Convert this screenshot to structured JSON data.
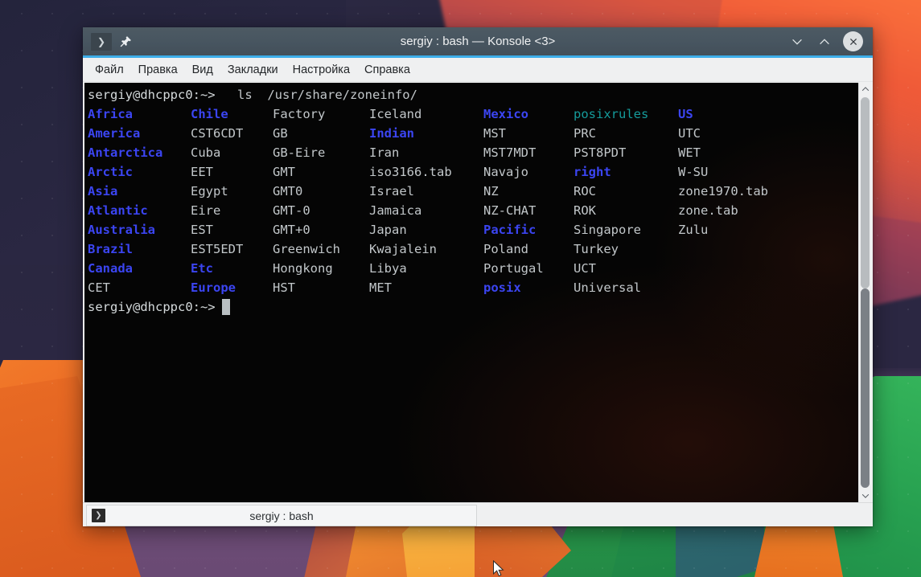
{
  "window": {
    "title": "sergiy : bash — Konsole <3>",
    "new_tab_icon": "terminal-chevron-icon",
    "pin_icon": "pin-icon",
    "minimize_icon": "chevron-down-icon",
    "maximize_icon": "chevron-up-icon",
    "close_icon": "close-icon",
    "accent_color": "#3daee9",
    "titlebar_color": "#475560"
  },
  "menubar": {
    "items": [
      {
        "label": "Файл"
      },
      {
        "label": "Правка"
      },
      {
        "label": "Вид"
      },
      {
        "label": "Закладки"
      },
      {
        "label": "Настройка"
      },
      {
        "label": "Справка"
      }
    ]
  },
  "terminal": {
    "background_color": "#050505",
    "foreground_color": "#c8cdd0",
    "dir_color": "#3b45f2",
    "link_color": "#159b9b",
    "prompt_first": "sergiy@dhcppc0:~>",
    "command": "ls  /usr/share/zoneinfo/",
    "prompt_last": "sergiy@dhcppc0:~>",
    "cursor": "block",
    "columns": [
      [
        "Africa",
        "America",
        "Antarctica",
        "Arctic",
        "Asia",
        "Atlantic",
        "Australia",
        "Brazil",
        "Canada",
        "CET"
      ],
      [
        "Chile",
        "CST6CDT",
        "Cuba",
        "EET",
        "Egypt",
        "Eire",
        "EST",
        "EST5EDT",
        "Etc",
        "Europe"
      ],
      [
        "Factory",
        "GB",
        "GB-Eire",
        "GMT",
        "GMT0",
        "GMT-0",
        "GMT+0",
        "Greenwich",
        "Hongkong",
        "HST"
      ],
      [
        "Iceland",
        "Indian",
        "Iran",
        "iso3166.tab",
        "Israel",
        "Jamaica",
        "Japan",
        "Kwajalein",
        "Libya",
        "MET"
      ],
      [
        "Mexico",
        "MST",
        "MST7MDT",
        "Navajo",
        "NZ",
        "NZ-CHAT",
        "Pacific",
        "Poland",
        "Portugal",
        "posix"
      ],
      [
        "posixrules",
        "PRC",
        "PST8PDT",
        "right",
        "ROC",
        "ROK",
        "Singapore",
        "Turkey",
        "UCT",
        "Universal"
      ],
      [
        "US",
        "UTC",
        "WET",
        "W-SU",
        "zone1970.tab",
        "zone.tab",
        "Zulu",
        "",
        "",
        ""
      ]
    ],
    "types": [
      [
        "dir",
        "dir",
        "dir",
        "dir",
        "dir",
        "dir",
        "dir",
        "dir",
        "dir",
        "file"
      ],
      [
        "dir",
        "file",
        "file",
        "file",
        "file",
        "file",
        "file",
        "file",
        "dir",
        "dir"
      ],
      [
        "file",
        "file",
        "file",
        "file",
        "file",
        "file",
        "file",
        "file",
        "file",
        "file"
      ],
      [
        "file",
        "dir",
        "file",
        "file",
        "file",
        "file",
        "file",
        "file",
        "file",
        "file"
      ],
      [
        "dir",
        "file",
        "file",
        "file",
        "file",
        "file",
        "dir",
        "file",
        "file",
        "dir"
      ],
      [
        "link",
        "file",
        "file",
        "dir",
        "file",
        "file",
        "file",
        "file",
        "file",
        "file"
      ],
      [
        "dir",
        "file",
        "file",
        "file",
        "file",
        "file",
        "file",
        "",
        "",
        ""
      ]
    ]
  },
  "scrollbar": {
    "up_arrow_icon": "chevron-up-icon",
    "down_arrow_icon": "chevron-down-icon",
    "thumb_position": "bottom"
  },
  "tabbar": {
    "tabs": [
      {
        "label": "sergiy : bash",
        "icon": "terminal-icon",
        "active": true
      }
    ]
  },
  "desktop": {
    "cursor_icon": "mouse-pointer-icon"
  }
}
